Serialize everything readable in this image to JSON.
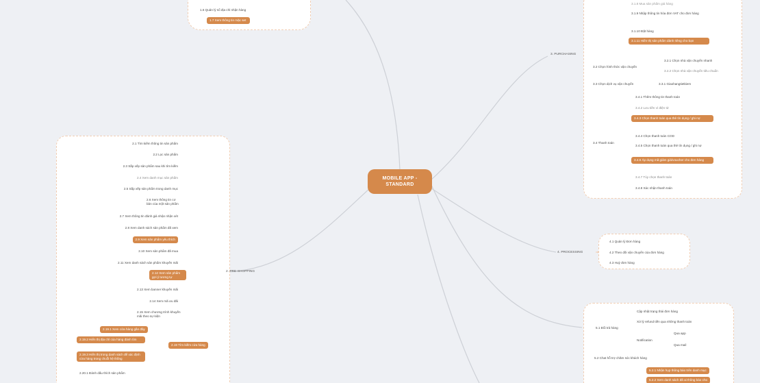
{
  "center": {
    "line1": "MOBILE APP -",
    "line2": "STANDARD"
  },
  "topleft": {
    "item_16": "1.6 Quản lý sổ địa chỉ nhận hàng",
    "item_17": "1.7 Xem thông tin mặc set"
  },
  "purchasing": {
    "label": "3. PURCHASING",
    "sub_31": {
      "items": [
        {
          "label": "3.1.8 Mua sản phẩm giá hàng",
          "hl": false
        },
        {
          "label": "3.1.9 Nhập thông tin hóa đơn VAT cho đơn hàng",
          "hl": false
        },
        {
          "label": "3.1.10 Đặt hàng",
          "hl": false
        },
        {
          "label": "3.1.11 Hiển thị sản phẩm dành riêng cho bạn",
          "hl": true
        }
      ]
    },
    "sub_32": {
      "label": "3.2 Chọn hình thức vận chuyển",
      "items": [
        "3.2.1 Chọn nhà vận chuyển nhanh",
        "3.2.2 Chọn nhà vận chuyển tiêu chuẩn"
      ]
    },
    "sub_33": {
      "label": "3.3 Chọn dịch vụ vận chuyển",
      "items": [
        "3.3.1 Giaohangtietkiem"
      ]
    },
    "sub_34": {
      "label": "3.4 Thanh toán",
      "items": [
        {
          "label": "3.4.1 Thêm thông tin thanh toán",
          "hl": false
        },
        {
          "label": "3.4.2 Lưu tiền ví điện tử",
          "hl": false
        },
        {
          "label": "3.4.3 Chọn thanh toán qua thẻ tín dụng / ghi nợ",
          "hl": true
        },
        {
          "label": "3.4.4 Chọn thanh toán COD",
          "hl": false
        },
        {
          "label": "3.4.5 Chọn thanh toán qua thẻ tín dụng / ghi nợ",
          "hl": false
        },
        {
          "label": "3.4.6 Áp dụng mã giảm giá/voucher cho đơn hàng",
          "hl": true
        },
        {
          "label": "3.4.7 Tùy chọn thanh toán",
          "hl": false
        },
        {
          "label": "3.4.8 Xác nhận thanh toán",
          "hl": false
        }
      ]
    }
  },
  "processing": {
    "label": "4. PROCESSING",
    "items": [
      "4.1 Quản lý Đơn hàng",
      "4.2 Theo dõi vận chuyển của đơn hàng",
      "4.3 Huỷ đơn hàng"
    ]
  },
  "preshopping": {
    "label": "2. PRE-SHOPPING",
    "items": [
      {
        "label": "2.1 Tìm kiếm thông tin sản phẩm",
        "hl": false
      },
      {
        "label": "2.2 Lọc sản phẩm",
        "hl": false
      },
      {
        "label": "2.3 Sắp xếp sản phẩm sau khi tìm kiếm",
        "hl": false
      },
      {
        "label": "2.4 Xem danh mục sản phẩm",
        "hl": false
      },
      {
        "label": "2.5 Sắp xếp sản phẩm trong danh mục",
        "hl": false
      },
      {
        "label": "2.6 Xem thông tin cơ bản của một sản phẩm",
        "hl": false
      },
      {
        "label": "2.7 Xem thông tin đánh giá nhận nhận xét",
        "hl": false
      },
      {
        "label": "2.8 Xem danh sách sản phẩm đã xem",
        "hl": false
      },
      {
        "label": "2.9 Xem sản phẩm yêu thích",
        "hl": true
      },
      {
        "label": "2.10 Xem sản phẩm đã mua",
        "hl": false
      },
      {
        "label": "2.11 Xem danh sách sản phẩm khuyến mãi",
        "hl": false
      },
      {
        "label": "2.12 Xem sản phẩm gợi ý tương tự",
        "hl": true
      },
      {
        "label": "2.13 Xem banner khuyến mãi",
        "hl": false
      },
      {
        "label": "2.14 Xem mã ưu đãi",
        "hl": false
      },
      {
        "label": "2.15 Xem chương trình khuyến mãi theo sự kiện",
        "hl": false
      }
    ],
    "sub_219": {
      "label": "2.19 Tìm kiếm cửa hàng",
      "items": [
        "2.19.1 Xem cửa hàng gần đây",
        "2.19.2 Hiển thị địa chỉ của hàng đánh tìm",
        "2.19.3 Hiển thị trong danh sách để xác định cửa hàng trong chuỗi hệ thống"
      ]
    },
    "item_220": "2.20.1 Đánh dấu thích sản phẩm"
  },
  "postpurchase": {
    "sub_51": {
      "label": "5.1 Đổi trả hàng",
      "items": [
        "Cập nhật trạng thái đơn hàng",
        "Xử lý refund tiền qua những thanh toán"
      ],
      "notification": {
        "label": "Notification",
        "items": [
          "Qua app",
          "Qua mail"
        ]
      }
    },
    "sub_52": {
      "label": "5.2 Chat hỗ trợ chăm sóc khách hàng",
      "items": [
        "5.2.1 Nhận hụp thông báo trên danh mục",
        "5.2.2 Xem danh sách đã ai thông báo cho"
      ]
    }
  },
  "colors": {
    "accent": "#d5894b",
    "background": "#eef0f4",
    "boundary": "#f1cdb2",
    "link": "#c9c9c9"
  }
}
